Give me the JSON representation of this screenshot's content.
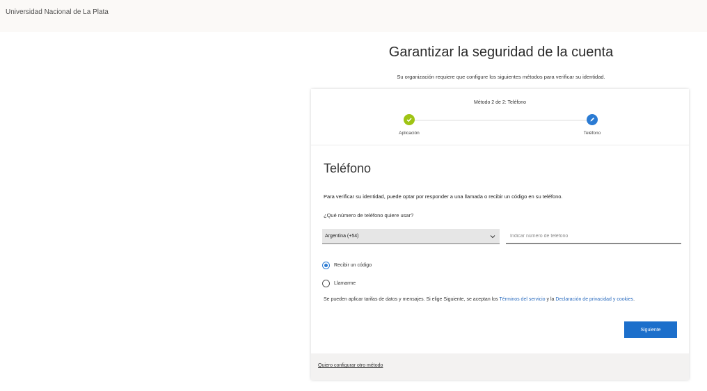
{
  "header": {
    "org_name": "Universidad Nacional de La Plata"
  },
  "page": {
    "title": "Garantizar la seguridad de la cuenta",
    "subtitle": "Su organización requiere que configure los siguientes métodos para verificar su identidad."
  },
  "wizard": {
    "step_title": "Método 2 de 2: Teléfono",
    "steps": [
      {
        "label": "Aplicación",
        "status": "done"
      },
      {
        "label": "Teléfono",
        "status": "current"
      }
    ]
  },
  "form": {
    "section_title": "Teléfono",
    "description": "Para verificar su identidad, puede optar por responder a una llamada o recibir un código en su teléfono.",
    "question": "¿Qué número de teléfono quiere usar?",
    "country_value": "Argentina (+54)",
    "phone_placeholder": "Indicar número de teléfono",
    "radio_options": [
      {
        "label": "Recibir un código",
        "checked": true
      },
      {
        "label": "Llamarme",
        "checked": false
      }
    ],
    "disclaimer_prefix": "Se pueden aplicar tarifas de datos y mensajes. Si elige Siguiente, se aceptan los",
    "terms_link": "Términos del servicio",
    "disclaimer_mid": "y la",
    "privacy_link": "Declaración de privacidad y cookies",
    "disclaimer_suffix": ".",
    "next_label": "Siguiente"
  },
  "footer": {
    "link_label": "Quiero configurar otro método"
  },
  "colors": {
    "accent": "#1c6fcb",
    "step_done": "#9fc414",
    "step_current": "#2b7bd3"
  }
}
